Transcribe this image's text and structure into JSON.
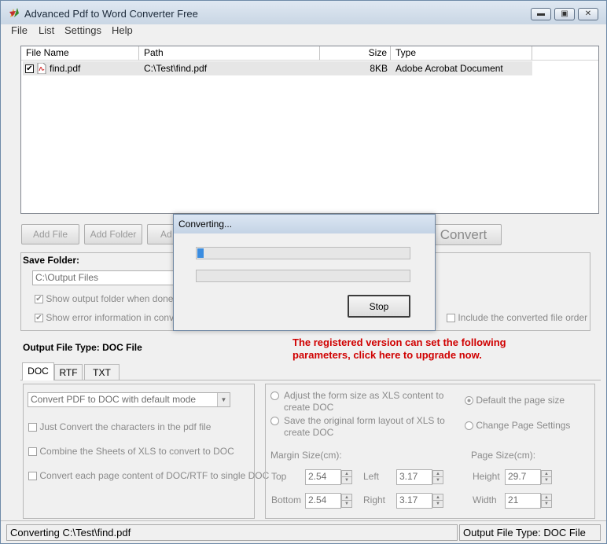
{
  "window": {
    "title": "Advanced Pdf to Word Converter Free",
    "min_glyph": "▬",
    "max_glyph": "▣",
    "close_glyph": "✕"
  },
  "menu": [
    "File",
    "List",
    "Settings",
    "Help"
  ],
  "file_list": {
    "columns": [
      "File Name",
      "Path",
      "Size",
      "Type"
    ],
    "rows": [
      {
        "checked": true,
        "name": "find.pdf",
        "path": "C:\\Test\\find.pdf",
        "size": "8KB",
        "type": "Adobe Acrobat Document"
      }
    ]
  },
  "buttons": {
    "add_file": "Add File",
    "add_folder": "Add Folder",
    "add_partial": "Ad",
    "convert": "Convert"
  },
  "save_folder": {
    "title": "Save Folder:",
    "path": "C:\\Output Files",
    "show_output": "Show output folder when done",
    "show_error": "Show error information in convers",
    "include_order": "Include the converted file order"
  },
  "dialog": {
    "title": "Converting...",
    "progress1": 0.03,
    "progress2": 0,
    "stop": "Stop"
  },
  "output_type": {
    "label": "Output File Type:",
    "value": "DOC File"
  },
  "upgrade_line1": "The registered version can set the following",
  "upgrade_line2": "parameters, click here to upgrade now.",
  "tabs": [
    "DOC",
    "RTF",
    "TXT"
  ],
  "doc_options": {
    "mode": "Convert PDF to DOC with default mode",
    "just_convert": "Just Convert the characters in the pdf file",
    "combine": "Combine the Sheets of XLS to convert to DOC",
    "each_page": "Convert each page content of DOC/RTF to single DOC"
  },
  "layout_options": {
    "adjust_1": "Adjust the form size as XLS content to",
    "adjust_2": "create DOC",
    "save_1": "Save the original form layout of XLS to",
    "save_2": "create DOC",
    "default_page": "Default the page size",
    "change_page": "Change Page Settings",
    "margin_title": "Margin Size(cm):",
    "page_title": "Page Size(cm):",
    "top_label": "Top",
    "top": "2.54",
    "left_label": "Left",
    "left": "3.17",
    "bottom_label": "Bottom",
    "bottom": "2.54",
    "right_label": "Right",
    "right": "3.17",
    "height_label": "Height",
    "height": "29.7",
    "width_label": "Width",
    "width": "21"
  },
  "status": {
    "left_label": "Converting",
    "left_path": "C:\\Test\\find.pdf",
    "right": "Output File Type:  DOC File"
  },
  "colors": {
    "upgrade_red": "#d00000",
    "progress_blue": "#3b8de0"
  }
}
